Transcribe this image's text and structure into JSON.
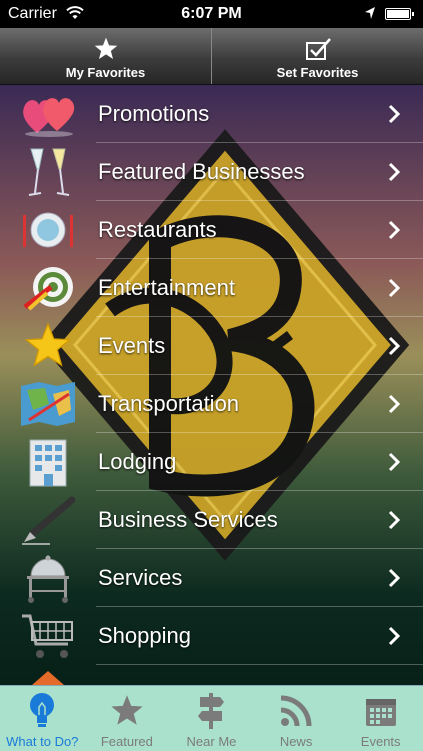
{
  "status": {
    "carrier": "Carrier",
    "time": "6:07 PM"
  },
  "favbar": {
    "my_favorites": "My Favorites",
    "set_favorites": "Set Favorites"
  },
  "menu": [
    {
      "label": "Promotions",
      "icon": "hearts-icon"
    },
    {
      "label": "Featured Businesses",
      "icon": "champagne-glasses-icon"
    },
    {
      "label": "Restaurants",
      "icon": "plate-fork-knife-icon"
    },
    {
      "label": "Entertainment",
      "icon": "target-darts-icon"
    },
    {
      "label": "Events",
      "icon": "star-icon"
    },
    {
      "label": "Transportation",
      "icon": "map-icon"
    },
    {
      "label": "Lodging",
      "icon": "building-icon"
    },
    {
      "label": "Business Services",
      "icon": "pen-icon"
    },
    {
      "label": "Services",
      "icon": "service-cart-icon"
    },
    {
      "label": "Shopping",
      "icon": "shopping-cart-icon"
    }
  ],
  "tabs": [
    {
      "label": "What to Do?",
      "icon": "lightbulb-icon",
      "active": true
    },
    {
      "label": "Featured",
      "icon": "star-icon",
      "active": false
    },
    {
      "label": "Near Me",
      "icon": "signpost-icon",
      "active": false
    },
    {
      "label": "News",
      "icon": "rss-icon",
      "active": false
    },
    {
      "label": "Events",
      "icon": "calendar-icon",
      "active": false
    }
  ]
}
